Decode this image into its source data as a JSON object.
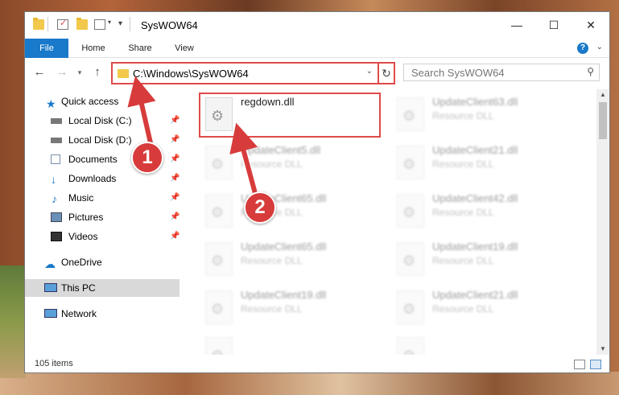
{
  "window": {
    "title": "SysWOW64"
  },
  "ribbon": {
    "tabs": [
      {
        "label": "File"
      },
      {
        "label": "Home"
      },
      {
        "label": "Share"
      },
      {
        "label": "View"
      }
    ]
  },
  "address": {
    "path": "C:\\Windows\\SysWOW64"
  },
  "search": {
    "placeholder": "Search SysWOW64"
  },
  "sidebar": {
    "items": [
      {
        "label": "Quick access",
        "icon": "star-icon"
      },
      {
        "label": "Local Disk (C:)",
        "icon": "drive-icon"
      },
      {
        "label": "Local Disk (D:)",
        "icon": "drive-icon"
      },
      {
        "label": "Documents",
        "icon": "documents-icon"
      },
      {
        "label": "Downloads",
        "icon": "download-icon"
      },
      {
        "label": "Music",
        "icon": "music-icon"
      },
      {
        "label": "Pictures",
        "icon": "pictures-icon"
      },
      {
        "label": "Videos",
        "icon": "videos-icon"
      },
      {
        "label": "OneDrive",
        "icon": "cloud-icon"
      },
      {
        "label": "This PC",
        "icon": "computer-icon"
      },
      {
        "label": "Network",
        "icon": "network-icon"
      }
    ]
  },
  "files": [
    {
      "name": "regdown.dll",
      "type": ""
    },
    {
      "name": "UpdateClient63.dll",
      "type": "Resource DLL"
    },
    {
      "name": "UpdateClient5.dll",
      "type": "Resource DLL"
    },
    {
      "name": "UpdateClient21.dll",
      "type": "Resource DLL"
    },
    {
      "name": "UpdateClient65.dll",
      "type": "Resource DLL"
    },
    {
      "name": "UpdateClient42.dll",
      "type": "Resource DLL"
    },
    {
      "name": "UpdateClient65.dll",
      "type": "Resource DLL"
    },
    {
      "name": "UpdateClient19.dll",
      "type": "Resource DLL"
    },
    {
      "name": "UpdateClient19.dll",
      "type": "Resource DLL"
    },
    {
      "name": "UpdateClient21.dll",
      "type": "Resource DLL"
    }
  ],
  "status": {
    "count": "105 items"
  },
  "callouts": [
    {
      "number": "1"
    },
    {
      "number": "2"
    }
  ],
  "colors": {
    "accent": "#1979ca",
    "highlight": "#e04a4a",
    "callout": "#d83b3b"
  }
}
